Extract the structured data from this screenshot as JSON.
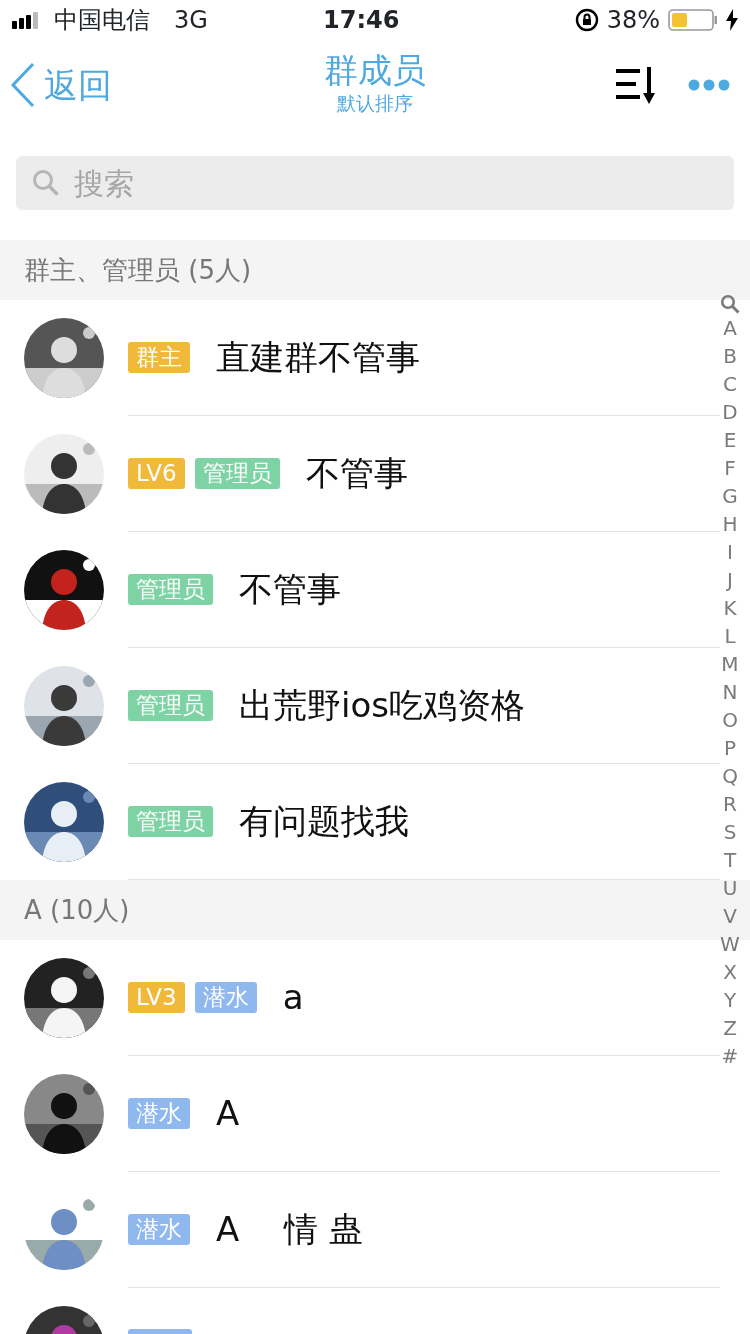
{
  "status_bar": {
    "carrier": "中国电信",
    "network": "3G",
    "time": "17:46",
    "battery": "38%"
  },
  "header": {
    "back": "返回",
    "title": "群成员",
    "subtitle": "默认排序"
  },
  "search": {
    "placeholder": "搜索"
  },
  "sections": [
    {
      "title": "群主、管理员 (5人)",
      "members": [
        {
          "tags": [
            {
              "kind": "owner",
              "label": "群主"
            }
          ],
          "name": "直建群不管事"
        },
        {
          "tags": [
            {
              "kind": "level",
              "label": "LV6"
            },
            {
              "kind": "admin",
              "label": "管理员"
            }
          ],
          "name": "不管事"
        },
        {
          "tags": [
            {
              "kind": "admin",
              "label": "管理员"
            }
          ],
          "name": "不管事"
        },
        {
          "tags": [
            {
              "kind": "admin",
              "label": "管理员"
            }
          ],
          "name": "出荒野ios吃鸡资格"
        },
        {
          "tags": [
            {
              "kind": "admin",
              "label": "管理员"
            }
          ],
          "name": "有问题找我"
        }
      ]
    },
    {
      "title": "A (10人)",
      "members": [
        {
          "tags": [
            {
              "kind": "level",
              "label": "LV3"
            },
            {
              "kind": "lurker",
              "label": "潜水"
            }
          ],
          "name": "a"
        },
        {
          "tags": [
            {
              "kind": "lurker",
              "label": "潜水"
            }
          ],
          "name": "A"
        },
        {
          "tags": [
            {
              "kind": "lurker",
              "label": "潜水"
            }
          ],
          "name": "A　 情 蛊"
        },
        {
          "tags": [
            {
              "kind": "lurker"
            }
          ]
        }
      ]
    }
  ],
  "index": [
    "A",
    "B",
    "C",
    "D",
    "E",
    "F",
    "G",
    "H",
    "I",
    "J",
    "K",
    "L",
    "M",
    "N",
    "O",
    "P",
    "Q",
    "R",
    "S",
    "T",
    "U",
    "V",
    "W",
    "X",
    "Y",
    "Z",
    "#"
  ]
}
